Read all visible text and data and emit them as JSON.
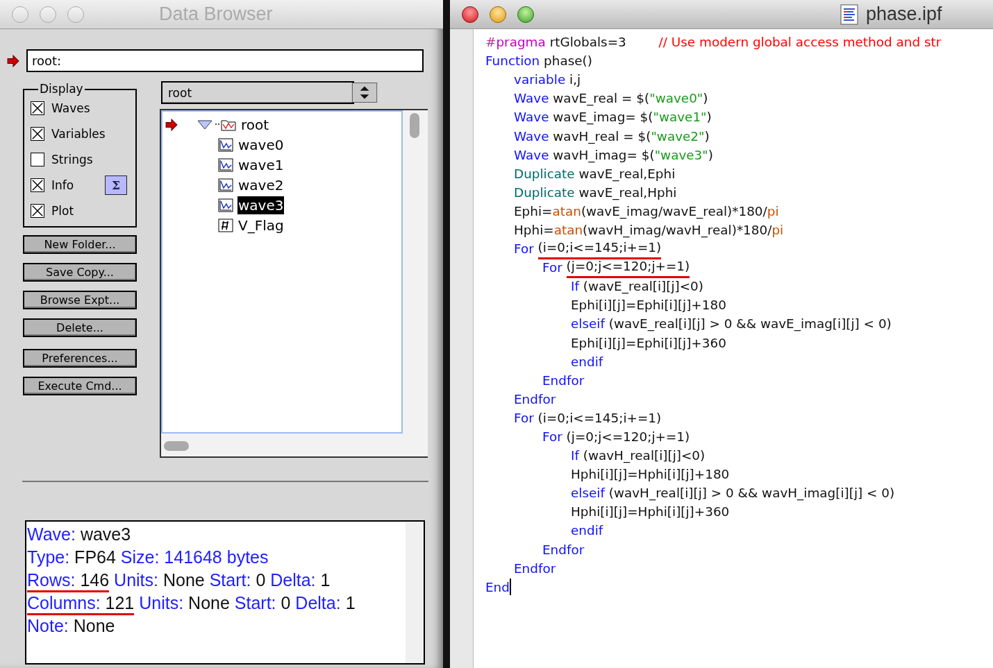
{
  "browser_window": {
    "title": "Data Browser",
    "path_field": {
      "value": "root:"
    },
    "display": {
      "title": "Display",
      "options": [
        {
          "label": "Waves",
          "checked": true
        },
        {
          "label": "Variables",
          "checked": true
        },
        {
          "label": "Strings",
          "checked": false
        },
        {
          "label": "Info",
          "checked": true,
          "button": "Σ"
        },
        {
          "label": "Plot",
          "checked": true
        }
      ]
    },
    "buttons": [
      "New Folder...",
      "Save Copy...",
      "Browse Expt...",
      "Delete...",
      "Preferences...",
      "Execute Cmd..."
    ],
    "folder_popup": {
      "value": "root"
    },
    "tree": [
      {
        "label": "root",
        "kind": "folder",
        "expanded": true,
        "current": true,
        "selected": false,
        "children": [
          {
            "label": "wave0",
            "kind": "wave",
            "selected": false
          },
          {
            "label": "wave1",
            "kind": "wave",
            "selected": false
          },
          {
            "label": "wave2",
            "kind": "wave",
            "selected": false
          },
          {
            "label": "wave3",
            "kind": "wave",
            "selected": true
          },
          {
            "label": "V_Flag",
            "kind": "variable",
            "selected": false
          }
        ]
      }
    ],
    "info": [
      [
        {
          "text": "Wave:",
          "kind": "label"
        },
        {
          "text": "wave3",
          "kind": "value"
        }
      ],
      [
        {
          "text": "Type:",
          "kind": "label"
        },
        {
          "text": "FP64",
          "kind": "value"
        },
        {
          "text": "  Size: 141648 bytes",
          "kind": "label"
        }
      ],
      [
        {
          "text": "Rows:",
          "kind": "label",
          "underlined": true
        },
        {
          "text": "146",
          "kind": "value",
          "underlined": true
        },
        {
          "text": "Units:",
          "kind": "label"
        },
        {
          "text": " None",
          "kind": "value"
        },
        {
          "text": "Start:",
          "kind": "label"
        },
        {
          "text": "0",
          "kind": "value"
        },
        {
          "text": "Delta:",
          "kind": "label"
        },
        {
          "text": "1",
          "kind": "value"
        }
      ],
      [
        {
          "text": "Columns:",
          "kind": "label",
          "underlined": true
        },
        {
          "text": "121",
          "kind": "value",
          "underlined": true
        },
        {
          "text": "Units:",
          "kind": "label"
        },
        {
          "text": " None",
          "kind": "value"
        },
        {
          "text": "Start:",
          "kind": "label"
        },
        {
          "text": "0",
          "kind": "value"
        },
        {
          "text": "Delta:",
          "kind": "label"
        },
        {
          "text": "1",
          "kind": "value"
        }
      ],
      [
        {
          "text": "Note:",
          "kind": "label"
        },
        {
          "text": "None",
          "kind": "value"
        }
      ]
    ]
  },
  "editor_window": {
    "title": "phase.ipf",
    "code": [
      {
        "tokens": [
          {
            "text": "#",
            "kind": "hash"
          },
          {
            "text": "pragma",
            "kind": "directive"
          },
          {
            "text": " rtGlobals=3        ",
            "kind": "plain"
          },
          {
            "text": "// Use modern global access method and str",
            "kind": "comment"
          }
        ]
      },
      {
        "tokens": [
          {
            "text": "Function",
            "kind": "keyword"
          },
          {
            "text": " phase()",
            "kind": "plain"
          }
        ],
        "children": [
          {
            "tokens": [
              {
                "text": "variable",
                "kind": "keyword"
              },
              {
                "text": " i,j",
                "kind": "plain"
              }
            ]
          },
          {
            "tokens": [
              {
                "text": "Wave",
                "kind": "keyword"
              },
              {
                "text": " wavE_real = $(",
                "kind": "plain"
              },
              {
                "text": "\"wave0\"",
                "kind": "string"
              },
              {
                "text": ")",
                "kind": "plain"
              }
            ]
          },
          {
            "tokens": [
              {
                "text": "Wave",
                "kind": "keyword"
              },
              {
                "text": " wavE_imag= $(",
                "kind": "plain"
              },
              {
                "text": "\"wave1\"",
                "kind": "string"
              },
              {
                "text": ")",
                "kind": "plain"
              }
            ]
          },
          {
            "tokens": [
              {
                "text": "Wave",
                "kind": "keyword"
              },
              {
                "text": " wavH_real = $(",
                "kind": "plain"
              },
              {
                "text": "\"wave2\"",
                "kind": "string"
              },
              {
                "text": ")",
                "kind": "plain"
              }
            ]
          },
          {
            "tokens": [
              {
                "text": "Wave",
                "kind": "keyword"
              },
              {
                "text": " wavH_imag= $(",
                "kind": "plain"
              },
              {
                "text": "\"wave3\"",
                "kind": "string"
              },
              {
                "text": ")",
                "kind": "plain"
              }
            ]
          },
          {
            "tokens": [
              {
                "text": "Duplicate",
                "kind": "operation"
              },
              {
                "text": " wavE_real,Ephi",
                "kind": "plain"
              }
            ]
          },
          {
            "tokens": [
              {
                "text": "Duplicate",
                "kind": "operation"
              },
              {
                "text": " wavE_real,Hphi",
                "kind": "plain"
              }
            ]
          },
          {
            "tokens": [
              {
                "text": "Ephi=",
                "kind": "plain"
              },
              {
                "text": "atan",
                "kind": "function"
              },
              {
                "text": "(wavE_imag/wavE_real)*180/",
                "kind": "plain"
              },
              {
                "text": "pi",
                "kind": "function"
              }
            ]
          },
          {
            "tokens": [
              {
                "text": "Hphi=",
                "kind": "plain"
              },
              {
                "text": "atan",
                "kind": "function"
              },
              {
                "text": "(wavH_imag/wavH_real)*180/",
                "kind": "plain"
              },
              {
                "text": "pi",
                "kind": "function"
              }
            ]
          },
          {
            "tokens": [
              {
                "text": "For ",
                "kind": "keyword"
              },
              {
                "text": "(i=0;i<=145;i+=1)",
                "kind": "plain",
                "underlined": true
              }
            ],
            "children": [
              {
                "tokens": [
                  {
                    "text": "For ",
                    "kind": "keyword"
                  },
                  {
                    "text": "(j=0;j<=120;j+=1)",
                    "kind": "plain",
                    "underlined": true
                  }
                ],
                "children": [
                  {
                    "tokens": [
                      {
                        "text": "If",
                        "kind": "keyword"
                      },
                      {
                        "text": " (wavE_real[i][j]<0)",
                        "kind": "plain"
                      }
                    ]
                  },
                  {
                    "tokens": [
                      {
                        "text": "Ephi[i][j]=Ephi[i][j]+180",
                        "kind": "plain"
                      }
                    ]
                  },
                  {
                    "tokens": [
                      {
                        "text": "elseif",
                        "kind": "keyword"
                      },
                      {
                        "text": " (wavE_real[i][j] > 0 && wavE_imag[i][j] < 0)",
                        "kind": "plain"
                      }
                    ]
                  },
                  {
                    "tokens": [
                      {
                        "text": "Ephi[i][j]=Ephi[i][j]+360",
                        "kind": "plain"
                      }
                    ]
                  },
                  {
                    "tokens": [
                      {
                        "text": "endif",
                        "kind": "keyword"
                      }
                    ]
                  }
                ]
              },
              {
                "tokens": [
                  {
                    "text": "Endfor",
                    "kind": "keyword"
                  }
                ]
              }
            ]
          },
          {
            "tokens": [
              {
                "text": "Endfor",
                "kind": "keyword"
              }
            ]
          },
          {
            "tokens": [
              {
                "text": "For",
                "kind": "keyword"
              },
              {
                "text": " (i=0;i<=145;i+=1)",
                "kind": "plain"
              }
            ],
            "children": [
              {
                "tokens": [
                  {
                    "text": "For",
                    "kind": "keyword"
                  },
                  {
                    "text": " (j=0;j<=120;j+=1)",
                    "kind": "plain"
                  }
                ],
                "children": [
                  {
                    "tokens": [
                      {
                        "text": "If",
                        "kind": "keyword"
                      },
                      {
                        "text": " (wavH_real[i][j]<0)",
                        "kind": "plain"
                      }
                    ]
                  },
                  {
                    "tokens": [
                      {
                        "text": "Hphi[i][j]=Hphi[i][j]+180",
                        "kind": "plain"
                      }
                    ]
                  },
                  {
                    "tokens": [
                      {
                        "text": "elseif",
                        "kind": "keyword"
                      },
                      {
                        "text": " (wavH_real[i][j] > 0 && wavH_imag[i][j] < 0)",
                        "kind": "plain"
                      }
                    ]
                  },
                  {
                    "tokens": [
                      {
                        "text": "Hphi[i][j]=Hphi[i][j]+360",
                        "kind": "plain"
                      }
                    ]
                  },
                  {
                    "tokens": [
                      {
                        "text": "endif",
                        "kind": "keyword"
                      }
                    ]
                  }
                ]
              },
              {
                "tokens": [
                  {
                    "text": "Endfor",
                    "kind": "keyword"
                  }
                ]
              }
            ]
          },
          {
            "tokens": [
              {
                "text": "Endfor",
                "kind": "keyword"
              }
            ]
          }
        ]
      },
      {
        "tokens": [
          {
            "text": "End",
            "kind": "keyword"
          }
        ],
        "cursor": true
      }
    ]
  }
}
